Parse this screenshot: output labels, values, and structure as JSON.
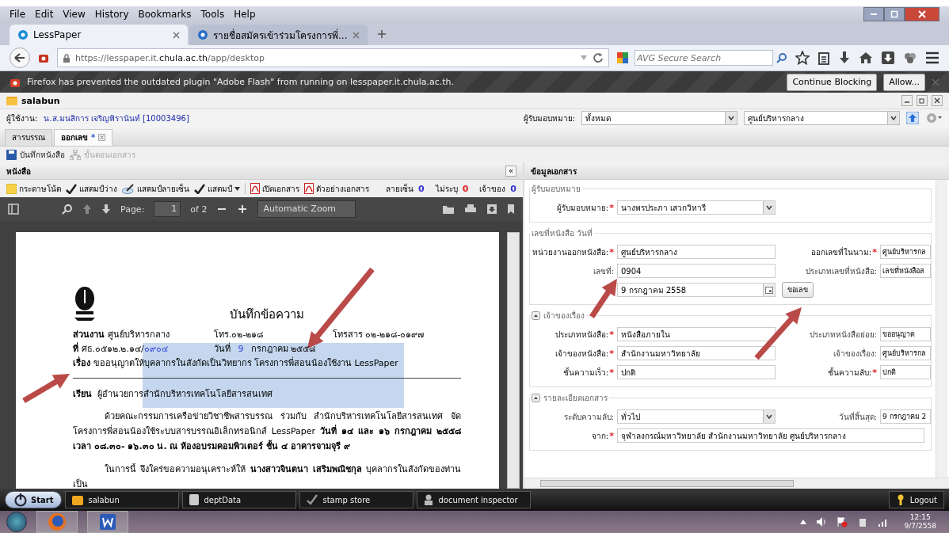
{
  "browser": {
    "menu": [
      "File",
      "Edit",
      "View",
      "History",
      "Bookmarks",
      "Tools",
      "Help"
    ],
    "tabs": [
      {
        "title": "LessPaper",
        "selected": true
      },
      {
        "title": "รายชื่อสมัครเข้าร่วมโครงการพี่...",
        "selected": false
      }
    ],
    "url": {
      "prefix": "https://lesspaper.it.",
      "host": "chula.ac.th",
      "path": "/app/desktop"
    },
    "search": {
      "placeholder": "AVG Secure Search"
    },
    "notification": {
      "message": "Firefox has prevented the outdated plugin \"Adobe Flash\" from running on lesspaper.it.chula.ac.th.",
      "buttons": [
        "Continue Blocking",
        "Allow..."
      ]
    }
  },
  "app": {
    "title": "salabun",
    "user_label": "ผู้ใช้งาน:",
    "user": "น.ส.มนสิการ เจริญพิรานันท์ [10003496]",
    "assignee_label": "ผู้รับมอบหมาย:",
    "assignee_filter": "ทั้งหมด",
    "unit_filter": "ศูนย์บริหารกลาง",
    "tabs": [
      {
        "label": "สารบรรณ",
        "selected": false,
        "closable": false
      },
      {
        "label": "ออกเลข",
        "marker": "*",
        "selected": true,
        "closable": true
      }
    ],
    "toolbar": [
      {
        "label": "บันทึกหนังสือ",
        "disabled": false,
        "kind": "save"
      },
      {
        "label": "ขั้นตอนเอกสาร",
        "disabled": true,
        "kind": "flow"
      }
    ]
  },
  "document_panel": {
    "title": "หนังสือ",
    "collapse": "«",
    "tools": [
      {
        "label": "กระดาษโน้ต",
        "kind": "note",
        "dropdown": false
      },
      {
        "label": "แสตมป์ว่าง",
        "kind": "stamp",
        "dropdown": false
      },
      {
        "label": "แสตมป์ลายเซ็น",
        "kind": "sign",
        "dropdown": false
      },
      {
        "label": "แสตมป์",
        "kind": "stamp",
        "dropdown": true
      },
      {
        "label": "เปิดเอกสาร",
        "kind": "pdf",
        "dropdown": false
      },
      {
        "label": "ตัวอย่างเอกสาร",
        "kind": "pdf",
        "dropdown": false
      }
    ],
    "counts": [
      {
        "label": "ลายเซ็น",
        "value": "0",
        "color": "#3333cc"
      },
      {
        "label": "ไม่ระบุ",
        "value": "0",
        "color": "#e02020"
      },
      {
        "label": "เจ้าของ",
        "value": "0",
        "color": "#3333cc"
      }
    ],
    "viewer": {
      "page_label": "Page:",
      "page": "1",
      "of": "of 2",
      "zoom": "Automatic Zoom"
    },
    "page": {
      "title": "บันทึกข้อความ",
      "dept_label": "ส่วนงาน",
      "dept": "ศูนย์บริหารกลาง",
      "phone": "โทร.๐๒-๒๑๘",
      "fax": "โทรสาร ๐๒-๒๑๘-๐๑๙๗",
      "ref_label": "ที่",
      "ref": "ศธ.๐๕๑๒.๒.๑๔/",
      "ref_number": "๐๙๐๔",
      "date_label": "วันที่",
      "date_day": "9",
      "date_rest": "กรกฎาคม ๒๕๕๘",
      "subject_label": "เรื่อง",
      "subject": "ขออนุญาตให้บุคลากรในสังกัดเป็นวิทยากร โครงการพี่สอนน้องใช้งาน LessPaper",
      "to_label": "เรียน",
      "to": "ผู้อำนวยการสำนักบริหารเทคโนโลยีสารสนเทศ",
      "paragraphs": [
        "ด้วยคณะกรรมการเครือข่ายวิชาชีพสารบรรณ ร่วมกับ สำนักบริหารเทคโนโลยีสารสนเทศ จัดโครงการพี่สอนน้องใช้ระบบสารบรรณอิเล็กทรอนิกส์ LessPaper **วันที่ ๑๔ และ ๑๖ กรกฎาคม ๒๕๕๘ เวลา ๐๘.๓๐- ๑๖.๓๐ น. ณ ห้องอบรมคอมพิวเตอร์ ชั้น ๔ อาคารจามจุรี ๙**",
        "ในการนี้ จึงใคร่ขอความอนุเคราะห์ให้ **นางสาวจินตนา เสริมพณิชกุล** บุคลากรในสังกัดของท่านเป็น"
      ]
    }
  },
  "info_panel": {
    "title": "ข้อมูลเอกสาร",
    "required_mark": "*",
    "sections": [
      {
        "title": "ผู้รับมอบหมาย",
        "collapsible": false,
        "rows": [
          {
            "left": {
              "label": "ผู้รับมอบหมาย:",
              "value": "นางพรประภา เสวกวิหารี",
              "required": true,
              "kind": "select"
            }
          }
        ]
      },
      {
        "title": "เลขที่หนังสือ วันที่",
        "collapsible": false,
        "rows": [
          {
            "left": {
              "label": "หน่วยงานออกหนังสือ:",
              "value": "ศูนย์บริหารกลาง",
              "required": true,
              "kind": "text"
            },
            "right": {
              "label": "ออกเลขที่ในนาม:",
              "value": "ศูนย์บริหารกล",
              "required": true,
              "kind": "text"
            }
          },
          {
            "left": {
              "label": "เลขที่:",
              "value": "0904",
              "required": false,
              "kind": "text"
            },
            "right": {
              "label": "ประเภทเลขที่หนังสือ:",
              "value": "เลขที่หนังสือส",
              "required": false,
              "kind": "text"
            }
          },
          {
            "left": {
              "value": "9 กรกฎาคม 2558",
              "kind": "date"
            },
            "button": "ขอเลข"
          }
        ]
      },
      {
        "title": "เจ้าของเรื่อง",
        "collapsible": true,
        "rows": [
          {
            "left": {
              "label": "ประเภทหนังสือ:",
              "value": "หนังสือภายใน",
              "required": true,
              "kind": "text"
            },
            "right": {
              "label": "ประเภทหนังสือย่อย:",
              "value": "ขออนุญาต",
              "required": false,
              "kind": "text"
            }
          },
          {
            "left": {
              "label": "เจ้าของหนังสือ:",
              "value": "สำนักงานมหาวิทยาลัย",
              "required": true,
              "kind": "text"
            },
            "right": {
              "label": "เจ้าของเรื่อง:",
              "value": "ศูนย์บริหารกล",
              "required": false,
              "kind": "text"
            }
          },
          {
            "left": {
              "label": "ชั้นความเร็ว:",
              "value": "ปกติ",
              "required": true,
              "kind": "text"
            },
            "right": {
              "label": "ชั้นความลับ:",
              "value": "ปกติ",
              "required": true,
              "kind": "text"
            }
          }
        ]
      },
      {
        "title": "รายละเอียดเอกสาร",
        "collapsible": true,
        "rows": [
          {
            "left": {
              "label": "ระดับความลับ:",
              "value": "ทั่วไป",
              "required": false,
              "kind": "select"
            },
            "right": {
              "label": "วันที่สิ้นสุด:",
              "value": "9 กรกฎาคม 2",
              "required": false,
              "kind": "text"
            }
          },
          {
            "left": {
              "label": "จาก:",
              "value": "จุฬาลงกรณ์มหาวิทยาลัย สำนักงานมหาวิทยาลัย ศูนย์บริหารกลาง",
              "required": true,
              "kind": "wide"
            }
          }
        ]
      }
    ]
  },
  "app_taskbar": {
    "start": "Start",
    "items": [
      {
        "label": "salabun",
        "kind": "folder"
      },
      {
        "label": "deptData",
        "kind": "db"
      },
      {
        "label": "stamp store",
        "kind": "stamp"
      },
      {
        "label": "document inspector",
        "kind": "inspector"
      }
    ],
    "logout": "Logout"
  },
  "system_tray": {
    "time": "12:15",
    "date": "9/7/2558"
  }
}
